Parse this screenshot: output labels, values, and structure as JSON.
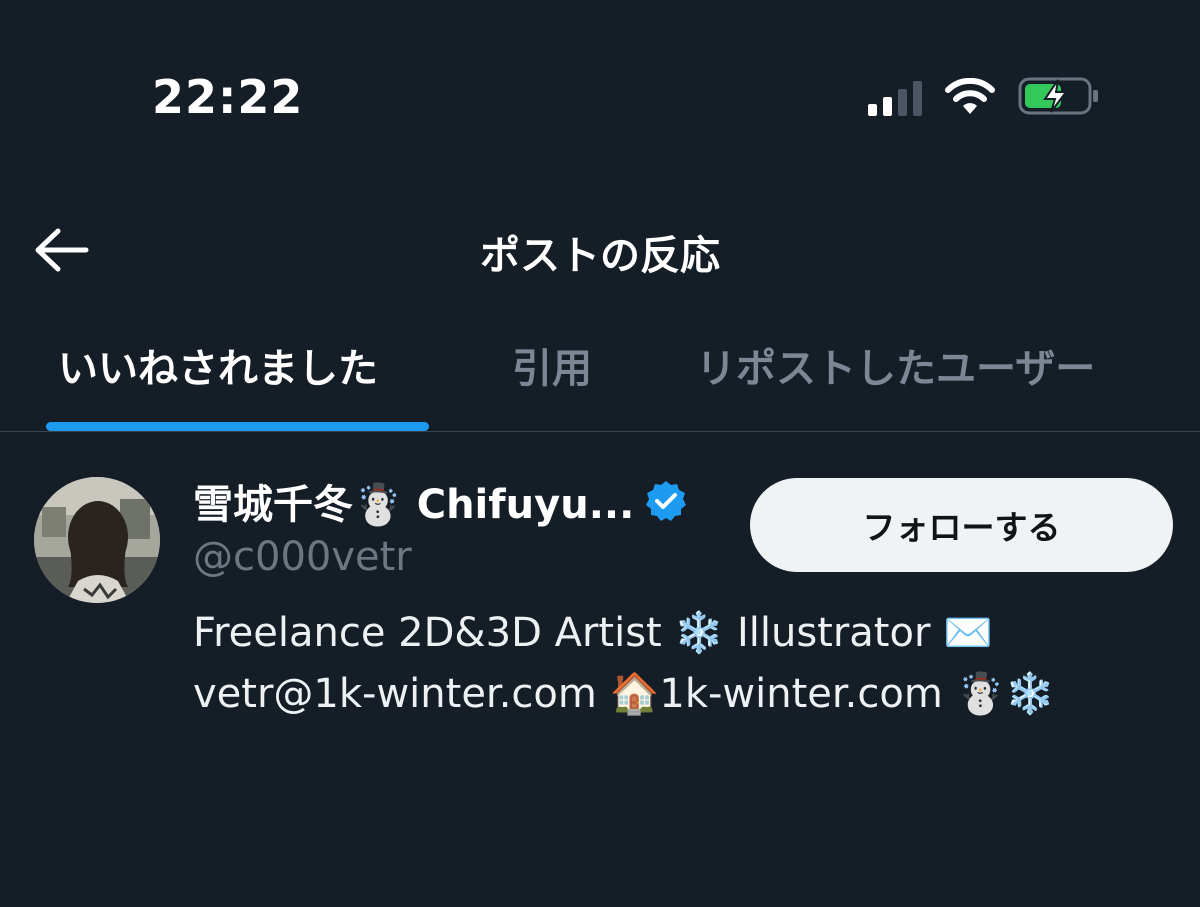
{
  "status_bar": {
    "time": "22:22",
    "signal_icon": "cellular-signal-icon",
    "wifi_icon": "wifi-icon",
    "battery_icon": "battery-charging-icon",
    "battery_color": "#34c759"
  },
  "header": {
    "back_icon": "arrow-left-icon",
    "title": "ポストの反応"
  },
  "tabs": [
    {
      "label": "いいねされました",
      "active": true
    },
    {
      "label": "引用",
      "active": false
    },
    {
      "label": "リポストしたユーザー",
      "active": false
    }
  ],
  "users": [
    {
      "display_name": "雪城千冬☃️ Chifuyu...",
      "handle": "@c000vetr",
      "verified": true,
      "verified_icon": "verified-badge-icon",
      "follow_label": "フォローする",
      "bio_lines": [
        "Freelance 2D&3D Artist ❄️ Illustrator ✉️",
        "vetr@1k-winter.com 🏠1k-winter.com ☃️❄️"
      ]
    }
  ],
  "colors": {
    "background": "#151d27",
    "accent": "#1d9bf0",
    "muted_text": "#6e7781",
    "follow_button_bg": "#eff3f4"
  }
}
